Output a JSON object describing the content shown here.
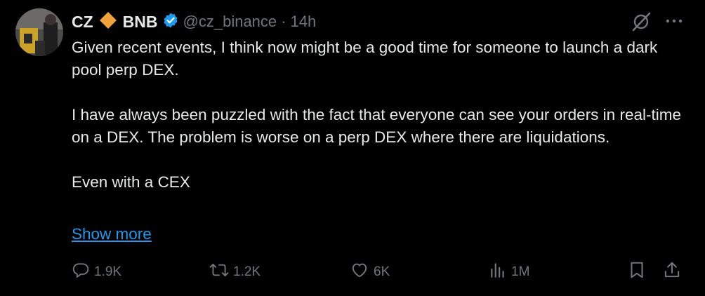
{
  "tweet": {
    "display_name": "CZ",
    "brand_label": "BNB",
    "handle": "@cz_binance",
    "separator": "·",
    "time": "14h",
    "paragraphs": [
      "Given recent events, I think now might be a good time for someone to launch a dark pool perp DEX.",
      "I have always been puzzled with the fact that everyone can see your orders in real-time on a DEX. The problem is worse on a perp DEX where there are liquidations.",
      "Even with a CEX"
    ],
    "show_more": "Show more"
  },
  "actions": {
    "reply": {
      "icon": "reply-icon",
      "count": "1.9K"
    },
    "retweet": {
      "icon": "retweet-icon",
      "count": "1.2K"
    },
    "like": {
      "icon": "heart-icon",
      "count": "6K"
    },
    "views": {
      "icon": "views-icon",
      "count": "1M"
    },
    "bookmark": {
      "icon": "bookmark-icon"
    },
    "share": {
      "icon": "share-icon"
    }
  },
  "colors": {
    "background": "#000000",
    "text": "#e7e9ea",
    "muted": "#71767b",
    "link": "#1d9bf0",
    "verified": "#1d9bf0",
    "diamond": "#f0a33a"
  }
}
